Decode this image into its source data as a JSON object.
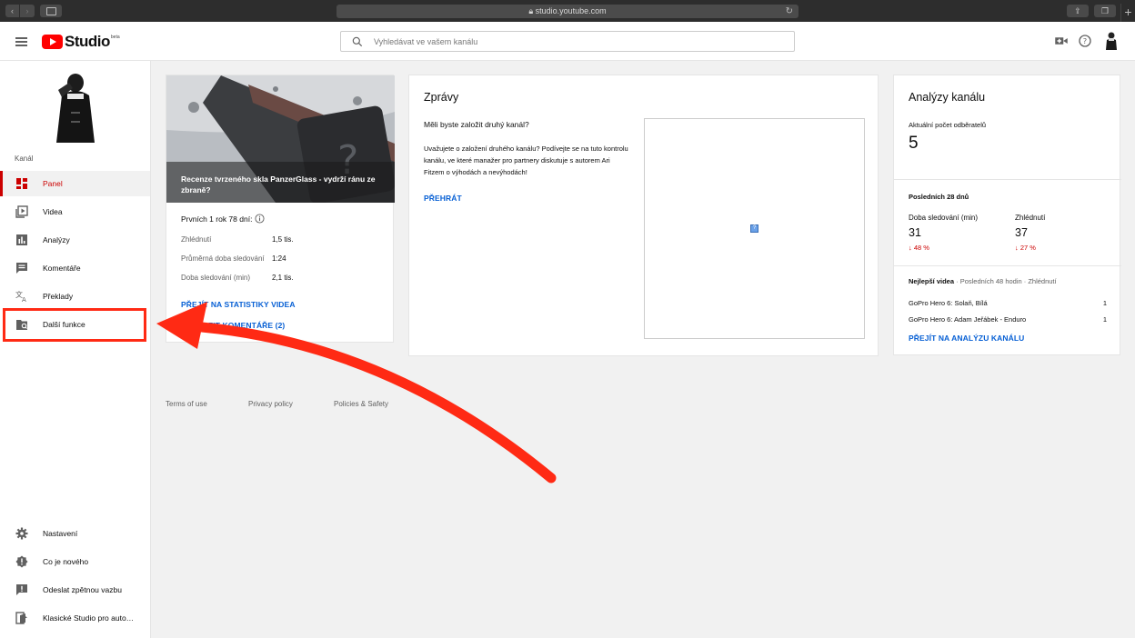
{
  "browser": {
    "url": "studio.youtube.com"
  },
  "header": {
    "logo_text": "Studio",
    "logo_badge": "beta",
    "search_placeholder": "Vyhledávat ve vašem kanálu",
    "icons": [
      "menu-icon",
      "search-icon",
      "create-video-icon",
      "help-icon",
      "account-avatar"
    ]
  },
  "sidebar": {
    "section_label": "Kanál",
    "items": [
      {
        "label": "Panel",
        "icon": "dashboard-icon",
        "active": true
      },
      {
        "label": "Videa",
        "icon": "videos-icon"
      },
      {
        "label": "Analýzy",
        "icon": "analytics-icon"
      },
      {
        "label": "Komentáře",
        "icon": "comments-icon"
      },
      {
        "label": "Překlady",
        "icon": "translate-icon"
      },
      {
        "label": "Další funkce",
        "icon": "more-features-icon"
      }
    ],
    "bottom_items": [
      {
        "label": "Nastavení",
        "icon": "gear-icon"
      },
      {
        "label": "Co je nového",
        "icon": "whats-new-icon"
      },
      {
        "label": "Odeslat zpětnou vazbu",
        "icon": "feedback-icon"
      },
      {
        "label": "Klasické Studio pro auto…",
        "icon": "classic-studio-icon"
      }
    ]
  },
  "video_card": {
    "title": "Recenze tvrzeného skla PanzerGlass - vydrží ránu ze zbraně?",
    "period": "Prvních 1 rok 78 dní:",
    "stats": [
      {
        "label": "Zhlédnutí",
        "value": "1,5 tis."
      },
      {
        "label": "Průměrná doba sledování",
        "value": "1:24"
      },
      {
        "label": "Doba sledování (min)",
        "value": "2,1 tis."
      }
    ],
    "link_stats": "PŘEJÍT NA STATISTIKY VIDEA",
    "link_comments": "ZIT KOMENTÁŘE (2)"
  },
  "news_card": {
    "title": "Zprávy",
    "subtitle": "Měli byste založit druhý kanál?",
    "body": "Uvažujete o založení druhého kanálu? Podívejte se na tuto kontrolu kanálu, ve které manažer pro partnery diskutuje s autorem Ari Fitzem o výhodách a nevýhodách!",
    "action": "PŘEHRÁT",
    "placeholder_glyph": "?"
  },
  "analytics_card": {
    "title": "Analýzy kanálu",
    "subscribers_label": "Aktuální počet odběratelů",
    "subscribers_value": "5",
    "period": "Posledních 28 dnů",
    "metrics": [
      {
        "label": "Doba sledování (min)",
        "value": "31",
        "delta": "48 %"
      },
      {
        "label": "Zhlédnutí",
        "value": "37",
        "delta": "27 %"
      }
    ],
    "top_videos_heading": "Nejlepší videa",
    "top_videos_meta": " · Posledních 48 hodin · Zhlédnutí",
    "top_videos": [
      {
        "title": "GoPro Hero 6: Solaň, Bílá",
        "views": "1"
      },
      {
        "title": "GoPro Hero 6: Adam Jeřábek - Enduro",
        "views": "1"
      }
    ],
    "link": "PŘEJÍT NA ANALÝZU KANÁLU",
    "delta_arrow": "↓"
  },
  "footer": {
    "links": [
      "Terms of use",
      "Privacy policy",
      "Policies & Safety"
    ]
  },
  "colors": {
    "accent": "#cc0000",
    "link": "#065fd4",
    "annotation": "#ff2a14"
  }
}
